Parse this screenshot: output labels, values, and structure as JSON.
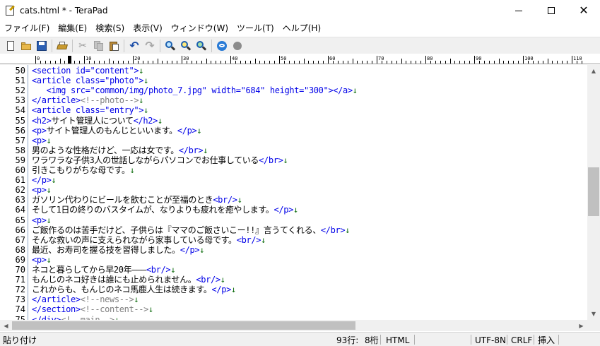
{
  "window": {
    "title": "cats.html * - TeraPad",
    "controls": {
      "minimize": "—",
      "maximize": "☐",
      "close": "✕"
    }
  },
  "menu": [
    "ファイル(F)",
    "編集(E)",
    "検索(S)",
    "表示(V)",
    "ウィンドウ(W)",
    "ツール(T)",
    "ヘルプ(H)"
  ],
  "toolbar": {
    "icons": [
      "new-file-icon",
      "open-folder-icon",
      "save-icon",
      "print-icon",
      "cut-icon",
      "copy-icon",
      "paste-icon",
      "undo-icon",
      "redo-icon",
      "find-icon",
      "find-next-icon",
      "find-prev-icon",
      "browser-icon",
      "stop-icon"
    ]
  },
  "ruler": {
    "labels": [
      "0",
      "10",
      "20",
      "30",
      "40",
      "50",
      "60",
      "70",
      "80",
      "90",
      "100",
      "110"
    ]
  },
  "editor": {
    "lines": [
      {
        "n": "50",
        "segs": [
          [
            "tag",
            "<section id=\"content\">"
          ],
          [
            "eol",
            "↓"
          ]
        ]
      },
      {
        "n": "51",
        "segs": [
          [
            "tag",
            "<article class=\"photo\">"
          ],
          [
            "eol",
            "↓"
          ]
        ]
      },
      {
        "n": "52",
        "segs": [
          [
            "txt",
            "   "
          ],
          [
            "tag",
            "<img src=\"common/img/photo_7.jpg\" width=\"684\" height=\"300\"></a>"
          ],
          [
            "eol",
            "↓"
          ]
        ]
      },
      {
        "n": "53",
        "segs": [
          [
            "tag",
            "</article>"
          ],
          [
            "cmt",
            "<!--photo-->"
          ],
          [
            "eol",
            "↓"
          ]
        ]
      },
      {
        "n": "54",
        "segs": [
          [
            "tag",
            "<article class=\"entry\">"
          ],
          [
            "eol",
            "↓"
          ]
        ]
      },
      {
        "n": "55",
        "segs": [
          [
            "tag",
            "<h2>"
          ],
          [
            "txt",
            "サイト管理人について"
          ],
          [
            "tag",
            "</h2>"
          ],
          [
            "eol",
            "↓"
          ]
        ]
      },
      {
        "n": "56",
        "segs": [
          [
            "tag",
            "<p>"
          ],
          [
            "txt",
            "サイト管理人のもんじといいます。"
          ],
          [
            "tag",
            "</p>"
          ],
          [
            "eol",
            "↓"
          ]
        ]
      },
      {
        "n": "57",
        "segs": [
          [
            "tag",
            "<p>"
          ],
          [
            "eol",
            "↓"
          ]
        ]
      },
      {
        "n": "58",
        "segs": [
          [
            "txt",
            "男のような性格だけど、一応は女です。"
          ],
          [
            "tag",
            "</br>"
          ],
          [
            "eol",
            "↓"
          ]
        ]
      },
      {
        "n": "59",
        "segs": [
          [
            "txt",
            "ワラワラな子供3人の世話しながらパソコンでお仕事している"
          ],
          [
            "tag",
            "</br>"
          ],
          [
            "eol",
            "↓"
          ]
        ]
      },
      {
        "n": "60",
        "segs": [
          [
            "txt",
            "引きこもりがちな母です。"
          ],
          [
            "eol",
            "↓"
          ]
        ]
      },
      {
        "n": "61",
        "segs": [
          [
            "tag",
            "</p>"
          ],
          [
            "eol",
            "↓"
          ]
        ]
      },
      {
        "n": "62",
        "segs": [
          [
            "tag",
            "<p>"
          ],
          [
            "eol",
            "↓"
          ]
        ]
      },
      {
        "n": "63",
        "segs": [
          [
            "txt",
            "ガソリン代わりにビールを飲むことが至福のとき"
          ],
          [
            "tag",
            "<br/>"
          ],
          [
            "eol",
            "↓"
          ]
        ]
      },
      {
        "n": "64",
        "segs": [
          [
            "txt",
            "そして1日の終りのバスタイムが、なりよりも疲れを癒やします。"
          ],
          [
            "tag",
            "</p>"
          ],
          [
            "eol",
            "↓"
          ]
        ]
      },
      {
        "n": "65",
        "segs": [
          [
            "tag",
            "<p>"
          ],
          [
            "eol",
            "↓"
          ]
        ]
      },
      {
        "n": "66",
        "segs": [
          [
            "txt",
            "ご飯作るのは苦手だけど、子供らは『ママのご飯さいこー!!』言うてくれる、"
          ],
          [
            "tag",
            "</br>"
          ],
          [
            "eol",
            "↓"
          ]
        ]
      },
      {
        "n": "67",
        "segs": [
          [
            "txt",
            "そんな救いの声に支えられながら家事している母です。"
          ],
          [
            "tag",
            "<br/>"
          ],
          [
            "eol",
            "↓"
          ]
        ]
      },
      {
        "n": "68",
        "segs": [
          [
            "txt",
            "最近、お寿司を握る技を習得しました。"
          ],
          [
            "tag",
            "</p>"
          ],
          [
            "eol",
            "↓"
          ]
        ]
      },
      {
        "n": "69",
        "segs": [
          [
            "tag",
            "<p>"
          ],
          [
            "eol",
            "↓"
          ]
        ]
      },
      {
        "n": "70",
        "segs": [
          [
            "txt",
            "ネコと暮らしてから早20年———"
          ],
          [
            "tag",
            "<br/>"
          ],
          [
            "eol",
            "↓"
          ]
        ]
      },
      {
        "n": "71",
        "segs": [
          [
            "txt",
            "もんじのネコ好きは誰にも止められません。"
          ],
          [
            "tag",
            "<br/>"
          ],
          [
            "eol",
            "↓"
          ]
        ]
      },
      {
        "n": "72",
        "segs": [
          [
            "txt",
            "これからも、もんじのネコ馬鹿人生は続きます。"
          ],
          [
            "tag",
            "</p>"
          ],
          [
            "eol",
            "↓"
          ]
        ]
      },
      {
        "n": "73",
        "segs": [
          [
            "tag",
            "</article>"
          ],
          [
            "cmt",
            "<!--news-->"
          ],
          [
            "eol",
            "↓"
          ]
        ]
      },
      {
        "n": "74",
        "segs": [
          [
            "tag",
            "</section>"
          ],
          [
            "cmt",
            "<!--content-->"
          ],
          [
            "eol",
            "↓"
          ]
        ]
      },
      {
        "n": "75",
        "segs": [
          [
            "tag",
            "</div>"
          ],
          [
            "cmt",
            "<!--main-->"
          ],
          [
            "eol",
            "↓"
          ]
        ]
      }
    ]
  },
  "status": {
    "message": "貼り付け",
    "line": "93行:",
    "column": "8桁",
    "mode": "HTML",
    "encoding": "UTF-8N",
    "newline": "CRLF",
    "insert": "挿入"
  }
}
